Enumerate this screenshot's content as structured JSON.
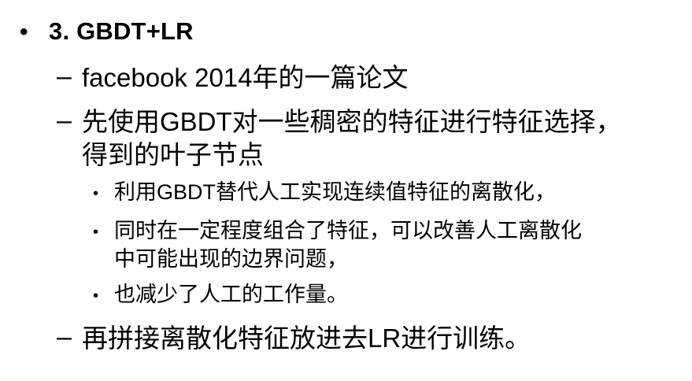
{
  "slide": {
    "heading": {
      "bullet": "•",
      "text": "3. GBDT+LR"
    },
    "items": [
      {
        "marker": "–",
        "lines": [
          "facebook  2014年的一篇论文"
        ]
      },
      {
        "marker": "–",
        "lines": [
          "先使用GBDT对一些稠密的特征进行特征选择，",
          "得到的叶子节点"
        ],
        "subitems": [
          {
            "marker": "•",
            "lines": [
              "利用GBDT替代人工实现连续值特征的离散化，"
            ]
          },
          {
            "marker": "•",
            "lines": [
              "同时在一定程度组合了特征，可以改善人工离散化",
              "中可能出现的边界问题，"
            ]
          },
          {
            "marker": "•",
            "lines": [
              "也减少了人工的工作量。"
            ]
          }
        ]
      },
      {
        "marker": "–",
        "lines": [
          "再拼接离散化特征放进去LR进行训练。"
        ]
      }
    ]
  }
}
